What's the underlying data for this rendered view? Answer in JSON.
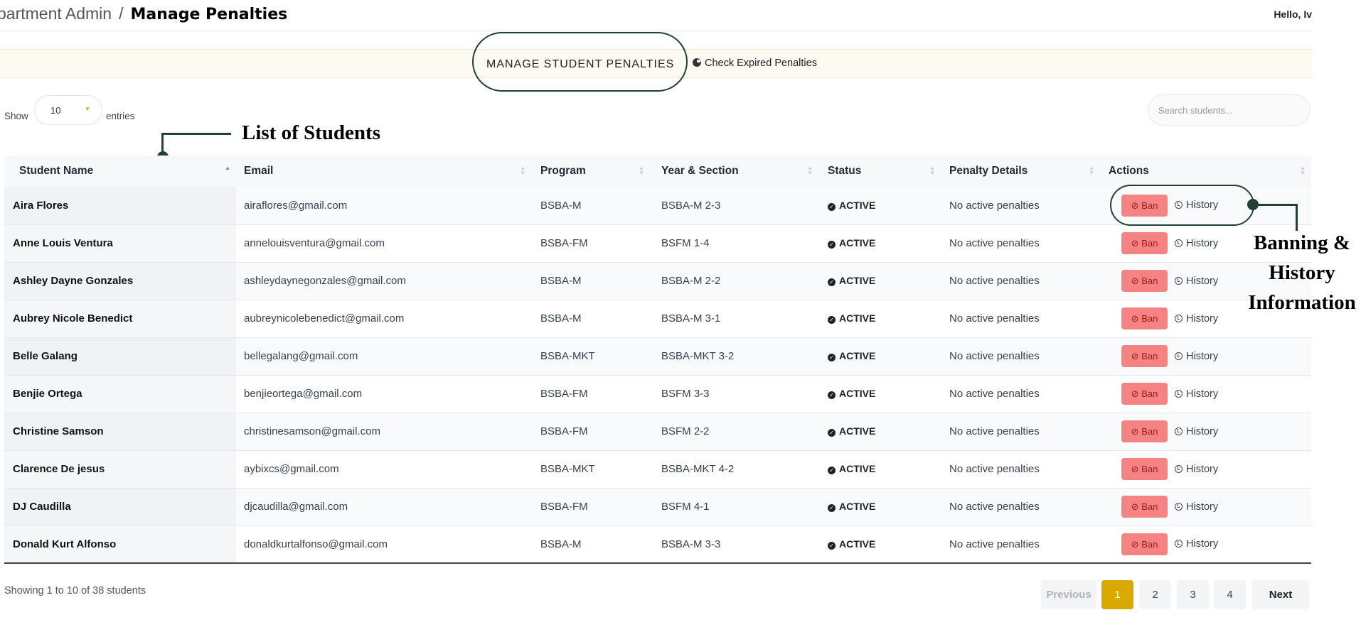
{
  "breadcrumb": {
    "parent": "partment Admin",
    "separator": "/",
    "current": "Manage Penalties"
  },
  "header": {
    "greeting": "Hello, Iv"
  },
  "banner": {
    "title": "MANAGE STUDENT PENALTIES",
    "check_expired": "Check Expired Penalties"
  },
  "annotations": {
    "list_label": "List of Students",
    "actions_label_line1": "Banning &",
    "actions_label_line2": "History",
    "actions_label_line3": "Information"
  },
  "controls": {
    "show_label": "Show",
    "entries_value": "10",
    "entries_label": "entries",
    "search_placeholder": "Search students..."
  },
  "table": {
    "columns": [
      "Student Name",
      "Email",
      "Program",
      "Year & Section",
      "Status",
      "Penalty Details",
      "Actions"
    ],
    "rows": [
      {
        "name": "Aira Flores",
        "email": "airaflores@gmail.com",
        "program": "BSBA-M",
        "section": "BSBA-M 2-3",
        "status": "ACTIVE",
        "penalty": "No active penalties"
      },
      {
        "name": "Anne Louis Ventura",
        "email": "annelouisventura@gmail.com",
        "program": "BSBA-FM",
        "section": "BSFM 1-4",
        "status": "ACTIVE",
        "penalty": "No active penalties"
      },
      {
        "name": "Ashley Dayne Gonzales",
        "email": "ashleydaynegonzales@gmail.com",
        "program": "BSBA-M",
        "section": "BSBA-M 2-2",
        "status": "ACTIVE",
        "penalty": "No active penalties"
      },
      {
        "name": "Aubrey Nicole Benedict",
        "email": "aubreynicolebenedict@gmail.com",
        "program": "BSBA-M",
        "section": "BSBA-M 3-1",
        "status": "ACTIVE",
        "penalty": "No active penalties"
      },
      {
        "name": "Belle Galang",
        "email": "bellegalang@gmail.com",
        "program": "BSBA-MKT",
        "section": "BSBA-MKT 3-2",
        "status": "ACTIVE",
        "penalty": "No active penalties"
      },
      {
        "name": "Benjie Ortega",
        "email": "benjieortega@gmail.com",
        "program": "BSBA-FM",
        "section": "BSFM 3-3",
        "status": "ACTIVE",
        "penalty": "No active penalties"
      },
      {
        "name": "Christine Samson",
        "email": "christinesamson@gmail.com",
        "program": "BSBA-FM",
        "section": "BSFM 2-2",
        "status": "ACTIVE",
        "penalty": "No active penalties"
      },
      {
        "name": "Clarence De jesus",
        "email": "aybixcs@gmail.com",
        "program": "BSBA-MKT",
        "section": "BSBA-MKT 4-2",
        "status": "ACTIVE",
        "penalty": "No active penalties"
      },
      {
        "name": "DJ Caudilla",
        "email": "djcaudilla@gmail.com",
        "program": "BSBA-FM",
        "section": "BSFM 4-1",
        "status": "ACTIVE",
        "penalty": "No active penalties"
      },
      {
        "name": "Donald Kurt Alfonso",
        "email": "donaldkurtalfonso@gmail.com",
        "program": "BSBA-M",
        "section": "BSBA-M 3-3",
        "status": "ACTIVE",
        "penalty": "No active penalties"
      }
    ],
    "ban_label": "Ban",
    "history_label": "History"
  },
  "footer": {
    "info": "Showing 1 to 10 of 38 students",
    "previous": "Previous",
    "pages": [
      "1",
      "2",
      "3",
      "4"
    ],
    "active_page": "1",
    "next": "Next"
  },
  "colors": {
    "accent": "#d9a900",
    "ban": "#f68383",
    "annotation": "#1f4233",
    "banner_bg": "#fdfaf2"
  },
  "icons": {
    "sort": "sort-arrows-icon",
    "status": "check-circle-icon",
    "ban": "ban-icon",
    "history": "history-clock-icon",
    "check_expired": "refresh-icon"
  }
}
